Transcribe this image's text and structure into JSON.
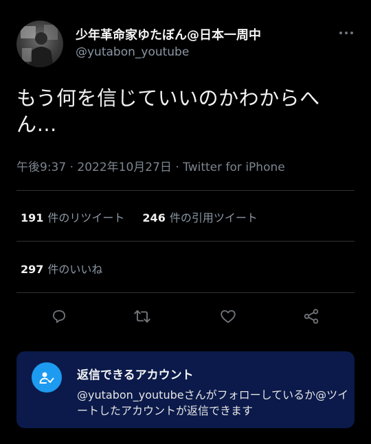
{
  "profile": {
    "display_name": "少年革命家ゆたぼん@日本一周中",
    "handle": "@yutabon_youtube",
    "avatar": "avatar-photo"
  },
  "header": {
    "more_icon": "more-horizontal-icon"
  },
  "tweet": {
    "text": "もう何を信じていいのかわからへん…",
    "time": "午後9:37",
    "date": "2022年10月27日",
    "separator": " · ",
    "source": "Twitter for iPhone"
  },
  "stats": {
    "retweets": {
      "count": "191",
      "label": "件のリツイート"
    },
    "quotes": {
      "count": "246",
      "label": "件の引用ツイート"
    },
    "likes": {
      "count": "297",
      "label": "件のいいね"
    }
  },
  "actions": {
    "reply_icon": "reply-icon",
    "retweet_icon": "retweet-icon",
    "like_icon": "heart-icon",
    "share_icon": "share-icon"
  },
  "reply_restriction": {
    "icon": "person-check-icon",
    "title": "返信できるアカウント",
    "description": "@yutabon_youtubeさんがフォローしているか@ツイートしたアカウントが返信できます"
  },
  "colors": {
    "background": "#000000",
    "secondary_text": "#8b98a5",
    "card_background": "#0b1a4a",
    "accent": "#1d9bf0"
  }
}
